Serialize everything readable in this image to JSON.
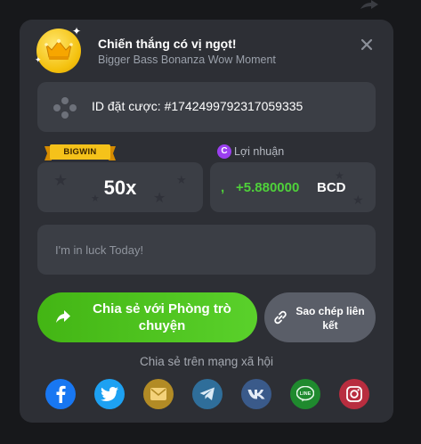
{
  "header": {
    "title": "Chiến thắng có vị ngọt!",
    "subtitle": "Bigger Bass Bonanza Wow Moment"
  },
  "bet": {
    "id_text": "ID đặt cược: #1742499792317059335"
  },
  "multiplier": {
    "badge": "BIGWIN",
    "value": "50x"
  },
  "profit": {
    "label": "Lợi nhuận",
    "currency_icon_letter": "C",
    "prefix": ",",
    "amount": "+5.880000",
    "currency": "BCD"
  },
  "message": {
    "placeholder": "I'm in luck Today!"
  },
  "actions": {
    "share_chat_label": "Chia sẻ với Phòng trò chuyện",
    "copy_link_label": "Sao chép liên kết"
  },
  "social": {
    "label": "Chia sẻ trên mạng xã hội",
    "networks": [
      {
        "name": "facebook-icon",
        "color": "#1877f2"
      },
      {
        "name": "twitter-icon",
        "color": "#1da1f2"
      },
      {
        "name": "email-icon",
        "color": "#b28b25"
      },
      {
        "name": "telegram-icon",
        "color": "#2f6e9a"
      },
      {
        "name": "vk-icon",
        "color": "#3a5a8a"
      },
      {
        "name": "line-icon",
        "color": "#1f8a2e"
      },
      {
        "name": "instagram-icon",
        "color": "#b82d3f"
      }
    ]
  },
  "colors": {
    "accent_green": "#4fd13a",
    "panel": "#2d2f35",
    "field": "#3b3e45"
  }
}
